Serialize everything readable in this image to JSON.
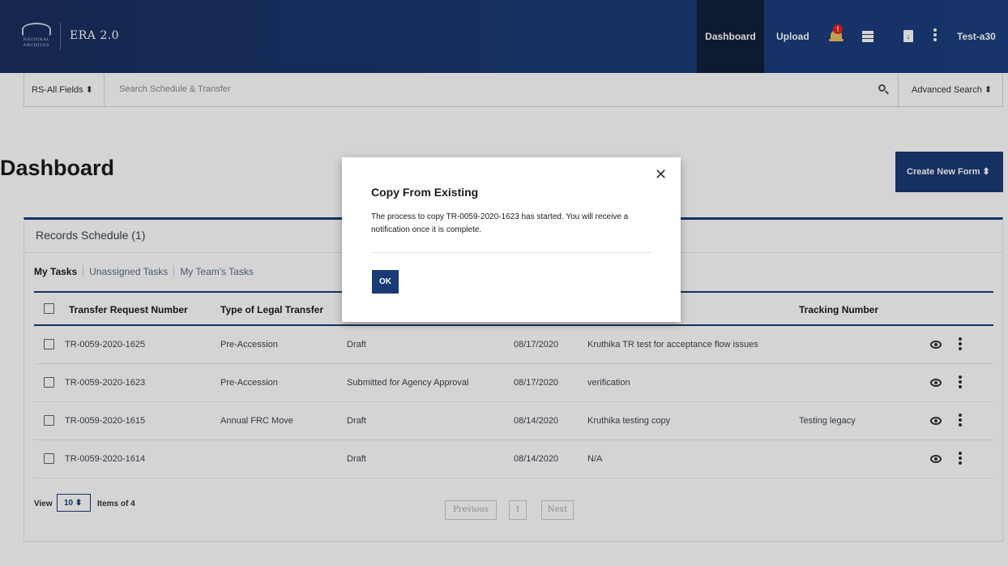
{
  "header": {
    "logo_line1": "NATIONAL",
    "logo_line2": "ARCHIVES",
    "app_title": "ERA 2.0",
    "nav_dashboard": "Dashboard",
    "nav_upload": "Upload",
    "notification_badge": "!",
    "user_name": "Test-a30"
  },
  "search": {
    "scope_label": "RS-All Fields",
    "placeholder": "Search Schedule & Transfer",
    "advanced_label": "Advanced Search"
  },
  "page": {
    "title": "Dashboard",
    "create_button": "Create New Form"
  },
  "card": {
    "title": "Records Schedule (1)",
    "tabs": [
      "My Tasks",
      "Unassigned Tasks",
      "My Team's Tasks"
    ],
    "columns": [
      "Transfer Request Number",
      "Type of Legal Transfer",
      "Tracking Number"
    ],
    "rows": [
      {
        "number": "TR-0059-2020-1625",
        "type": "Pre-Accession",
        "status": "Draft",
        "date": "08/17/2020",
        "description": "Kruthika TR test for acceptance flow issues",
        "tracking": ""
      },
      {
        "number": "TR-0059-2020-1623",
        "type": "Pre-Accession",
        "status": "Submitted for Agency Approval",
        "date": "08/17/2020",
        "description": "verification",
        "tracking": ""
      },
      {
        "number": "TR-0059-2020-1615",
        "type": "Annual FRC Move",
        "status": "Draft",
        "date": "08/14/2020",
        "description": "Kruthika testing copy",
        "tracking": "Testing legacy"
      },
      {
        "number": "TR-0059-2020-1614",
        "type": "",
        "status": "Draft",
        "date": "08/14/2020",
        "description": "N/A",
        "tracking": ""
      }
    ],
    "footer": {
      "view_label": "View",
      "page_size": "10",
      "items_label": "Items of 4",
      "previous": "Previous",
      "current_page": "1",
      "next": "Next"
    }
  },
  "modal": {
    "title": "Copy From Existing",
    "message": "The process to copy TR-0059-2020-1623 has started. You will receive a notification once it is complete.",
    "ok_label": "OK",
    "close_glyph": "✕"
  },
  "colors": {
    "brand_navy": "#1a3a75",
    "active_nav": "#111f3d",
    "bell": "#e9c15d",
    "badge_red": "#e02424"
  }
}
